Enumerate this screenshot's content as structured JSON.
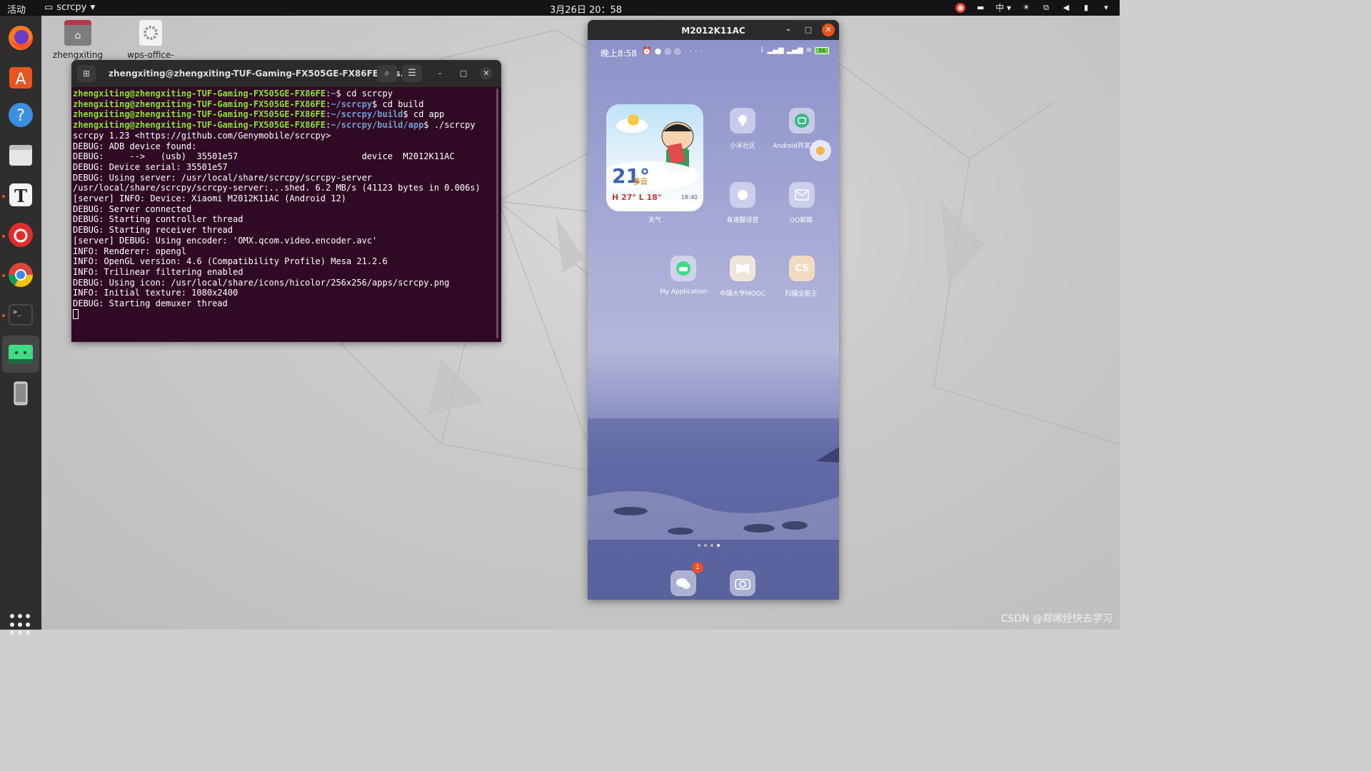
{
  "topbar": {
    "activities": "活动",
    "app_menu": "scrcpy",
    "clock": "3月26日  20：58",
    "input_method": "中"
  },
  "desktop": {
    "icons": [
      {
        "label": "zhengxiting"
      },
      {
        "label": "wps-office-"
      }
    ]
  },
  "terminal": {
    "title": "zhengxiting@zhengxiting-TUF-Gaming-FX505GE-FX86FE: ~/s...",
    "prompt_user": "zhengxiting@zhengxiting-TUF-Gaming-FX505GE-FX86FE",
    "lines": [
      {
        "path": "~",
        "cmd": "$ cd scrcpy"
      },
      {
        "path": "~/scrcpy",
        "cmd": "$ cd build"
      },
      {
        "path": "~/scrcpy/build",
        "cmd": "$ cd app"
      },
      {
        "path": "~/scrcpy/build/app",
        "cmd": "$ ./scrcpy"
      }
    ],
    "output": [
      "scrcpy 1.23 <https://github.com/Genymobile/scrcpy>",
      "DEBUG: ADB device found:",
      "DEBUG:     -->   (usb)  35501e57                        device  M2012K11AC",
      "DEBUG: Device serial: 35501e57",
      "DEBUG: Using server: /usr/local/share/scrcpy/scrcpy-server",
      "/usr/local/share/scrcpy/scrcpy-server:...shed. 6.2 MB/s (41123 bytes in 0.006s)",
      "[server] INFO: Device: Xiaomi M2012K11AC (Android 12)",
      "DEBUG: Server connected",
      "DEBUG: Starting controller thread",
      "DEBUG: Starting receiver thread",
      "[server] DEBUG: Using encoder: 'OMX.qcom.video.encoder.avc'",
      "INFO: Renderer: opengl",
      "INFO: OpenGL version: 4.6 (Compatibility Profile) Mesa 21.2.6",
      "INFO: Trilinear filtering enabled",
      "DEBUG: Using icon: /usr/local/share/icons/hicolor/256x256/apps/scrcpy.png",
      "INFO: Initial texture: 1080x2400",
      "DEBUG: Starting demuxer thread"
    ]
  },
  "phone_window": {
    "title": "M2012K11AC",
    "status_time": "晚上8:58",
    "battery": "54",
    "weather": {
      "temp": "21°",
      "condition": "多云",
      "high_low": "H 27°  L 18°",
      "sunset": "18:40",
      "label": "天气"
    },
    "apps": [
      {
        "label": "小米社区"
      },
      {
        "label": "Android开发工具箱"
      },
      {
        "label": "有道翻译官"
      },
      {
        "label": "QQ邮箱"
      },
      {
        "label": "My Application"
      },
      {
        "label": "中国大学MOOC"
      },
      {
        "label": "扫描全能王",
        "icon_text": "CS"
      }
    ],
    "dock_badge": "1"
  },
  "watermark": "CSDN @郑烯烃快去学习",
  "colors": {
    "terminal_bg": "#300a24",
    "prompt_user": "#8ae234",
    "prompt_path": "#729fcf",
    "close_orange": "#e9541a"
  }
}
